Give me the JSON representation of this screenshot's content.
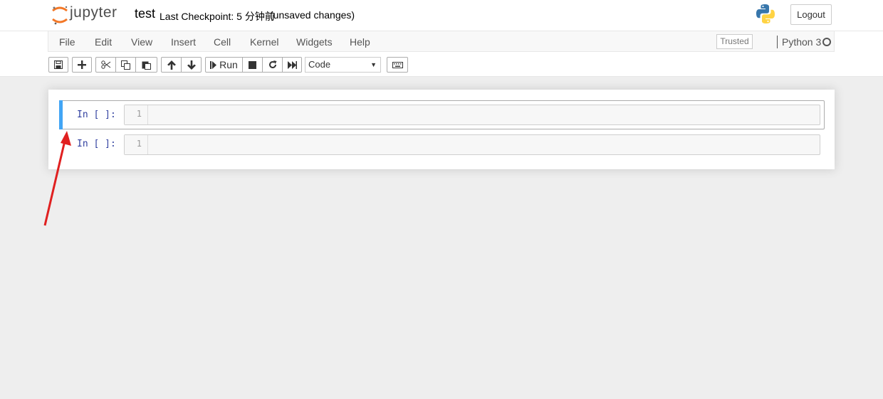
{
  "header": {
    "logo_text": "jupyter",
    "notebook_name": "test",
    "checkpoint": "Last Checkpoint: 5 分钟前",
    "save_status": "(unsaved changes)",
    "logout_label": "Logout",
    "python_logo_icon": "python-logo-icon",
    "accent_color": "#f37726"
  },
  "menubar": {
    "items": [
      "File",
      "Edit",
      "View",
      "Insert",
      "Cell",
      "Kernel",
      "Widgets",
      "Help"
    ],
    "trusted_label": "Trusted",
    "kernel_name": "Python 3"
  },
  "toolbar": {
    "buttons": [
      {
        "icon": "save-icon"
      },
      {
        "icon": "plus-icon"
      },
      {
        "icon": "cut-icon"
      },
      {
        "icon": "copy-icon"
      },
      {
        "icon": "paste-icon"
      },
      {
        "icon": "arrow-up-icon"
      },
      {
        "icon": "arrow-down-icon"
      },
      {
        "icon": "step-forward-icon",
        "label": "Run"
      },
      {
        "icon": "stop-icon"
      },
      {
        "icon": "restart-icon"
      },
      {
        "icon": "fast-forward-icon"
      },
      {
        "icon": "keyboard-icon"
      }
    ],
    "run_label": "Run",
    "cell_type": "Code"
  },
  "cells": [
    {
      "prompt": "In [ ]:",
      "line_number": "1",
      "selected": true
    },
    {
      "prompt": "In [ ]:",
      "line_number": "1",
      "selected": false
    }
  ],
  "colors": {
    "selected_cell_bar": "#42a5f5",
    "prompt": "#303f9f",
    "annotation_arrow": "#e02020"
  }
}
